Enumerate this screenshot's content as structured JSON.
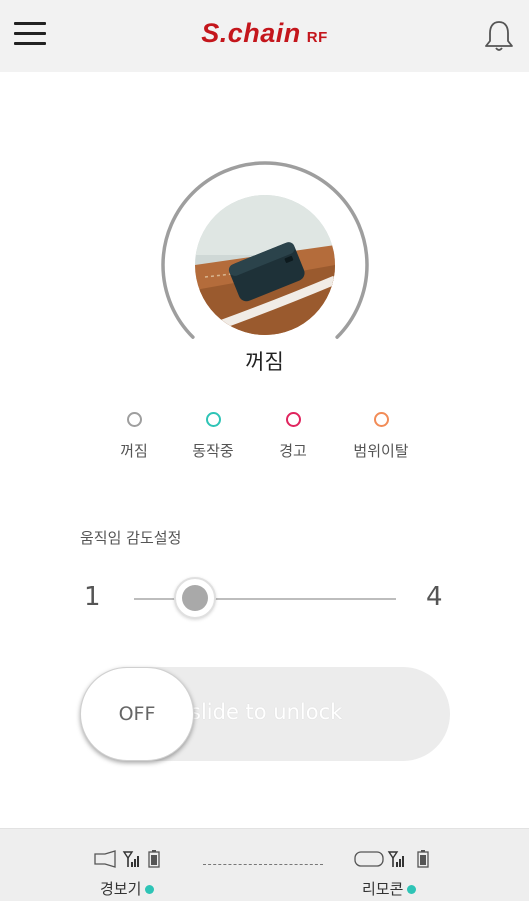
{
  "header": {
    "logo_main": "S.chain",
    "logo_sub": "RF"
  },
  "status": {
    "label": "꺼짐",
    "ring_color": "#9e9e9e",
    "progress": 0.75
  },
  "legend": [
    {
      "label": "꺼짐",
      "color": "#9e9e9e"
    },
    {
      "label": "동작중",
      "color": "#2ec4b6"
    },
    {
      "label": "경고",
      "color": "#e0245e"
    },
    {
      "label": "범위이탈",
      "color": "#f28c57"
    }
  ],
  "sensitivity": {
    "title": "움직임 감도설정",
    "min": "1",
    "max": "4",
    "value": 1.7
  },
  "unlock": {
    "knob_label": "OFF",
    "hint": "slide to unlock"
  },
  "footer": {
    "alarm": {
      "label": "경보기",
      "status_color": "#2ec4b6"
    },
    "remote": {
      "label": "리모콘",
      "status_color": "#2ec4b6"
    }
  }
}
